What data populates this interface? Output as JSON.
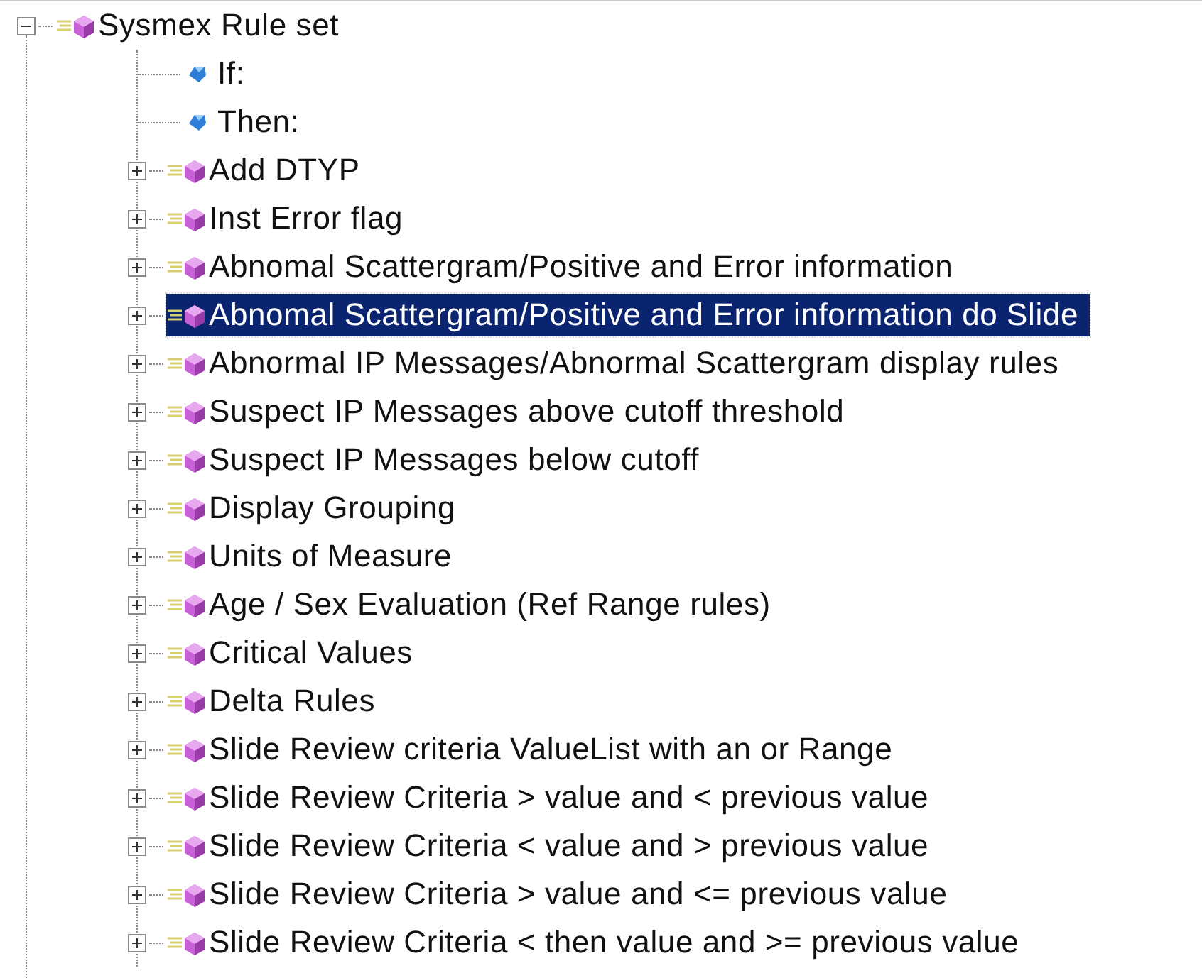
{
  "tree": {
    "label": "Sysmex Rule set",
    "kind": "rule",
    "expanded": true,
    "selected": false,
    "children": [
      {
        "label": "If:",
        "kind": "condition",
        "selected": false
      },
      {
        "label": "Then:",
        "kind": "condition",
        "selected": false
      },
      {
        "label": "Add DTYP",
        "kind": "rule",
        "expanded": false,
        "selected": false
      },
      {
        "label": "Inst Error flag",
        "kind": "rule",
        "expanded": false,
        "selected": false
      },
      {
        "label": "Abnomal Scattergram/Positive and Error information",
        "kind": "rule",
        "expanded": false,
        "selected": false
      },
      {
        "label": "Abnomal Scattergram/Positive and Error information do Slide",
        "kind": "rule",
        "expanded": false,
        "selected": true
      },
      {
        "label": "Abnormal  IP Messages/Abnormal Scattergram display rules",
        "kind": "rule",
        "expanded": false,
        "selected": false
      },
      {
        "label": "Suspect IP Messages  above cutoff threshold",
        "kind": "rule",
        "expanded": false,
        "selected": false
      },
      {
        "label": "Suspect IP Messages  below cutoff",
        "kind": "rule",
        "expanded": false,
        "selected": false
      },
      {
        "label": "Display Grouping",
        "kind": "rule",
        "expanded": false,
        "selected": false
      },
      {
        "label": "Units of Measure",
        "kind": "rule",
        "expanded": false,
        "selected": false
      },
      {
        "label": "Age / Sex Evaluation (Ref Range rules)",
        "kind": "rule",
        "expanded": false,
        "selected": false
      },
      {
        "label": "Critical Values",
        "kind": "rule",
        "expanded": false,
        "selected": false
      },
      {
        "label": "Delta Rules",
        "kind": "rule",
        "expanded": false,
        "selected": false
      },
      {
        "label": "Slide Review criteria ValueList with an or Range",
        "kind": "rule",
        "expanded": false,
        "selected": false
      },
      {
        "label": "Slide Review Criteria > value and < previous value",
        "kind": "rule",
        "expanded": false,
        "selected": false
      },
      {
        "label": "Slide Review Criteria < value and > previous value",
        "kind": "rule",
        "expanded": false,
        "selected": false
      },
      {
        "label": "Slide Review Criteria > value and <= previous value",
        "kind": "rule",
        "expanded": false,
        "selected": false
      },
      {
        "label": "Slide Review Criteria < then value and >= previous value",
        "kind": "rule",
        "expanded": false,
        "selected": false
      }
    ]
  }
}
